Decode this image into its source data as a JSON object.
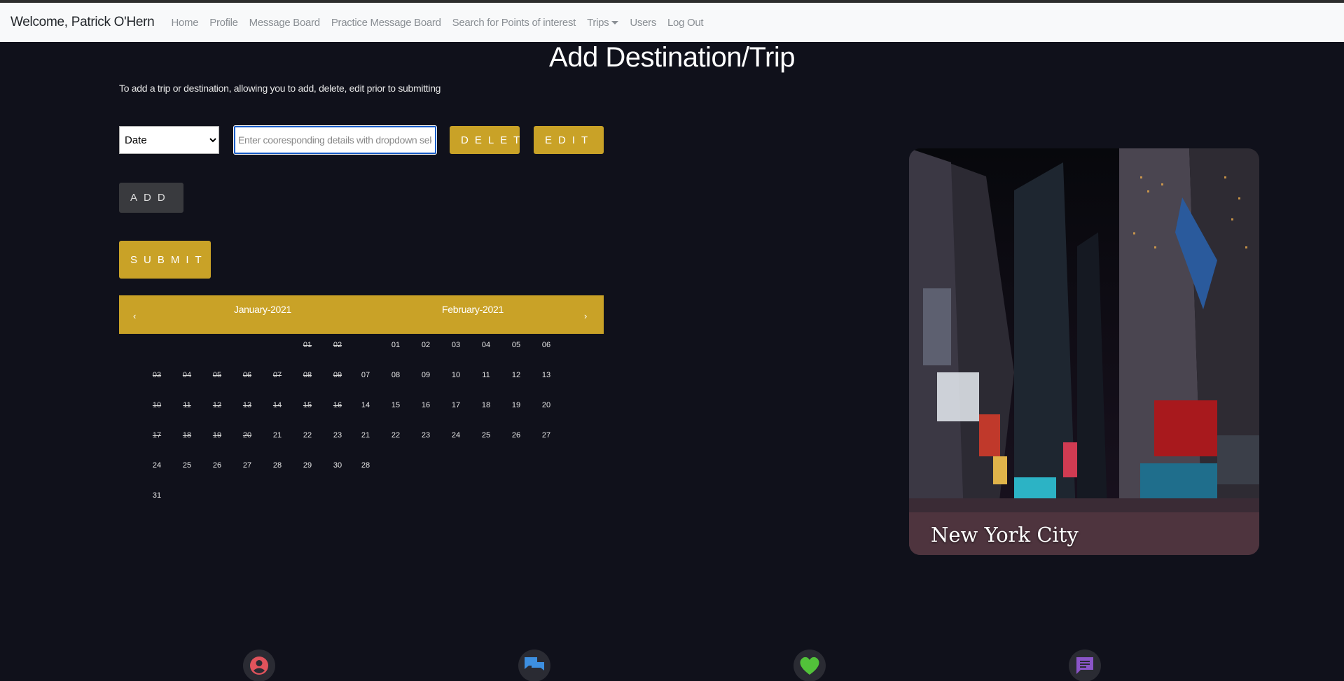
{
  "navbar": {
    "brand": "Welcome, Patrick O'Hern",
    "links": [
      "Home",
      "Profile",
      "Message Board",
      "Practice Message Board",
      "Search for Points of interest",
      "Trips",
      "Users",
      "Log Out"
    ]
  },
  "page": {
    "title": "Add Destination/Trip",
    "intro": "To add a trip or destination, allowing you to add, delete, edit prior to submitting"
  },
  "form": {
    "dropdown_selected": "Date",
    "details_placeholder": "Enter cooresponding details with dropdown selection",
    "details_value": "",
    "delete_label": "DELETE",
    "edit_label": "EDIT",
    "add_label": "ADD",
    "submit_label": "SUBMIT"
  },
  "calendar": {
    "prev_icon": "chevron-left-icon",
    "next_icon": "chevron-right-icon",
    "months": [
      {
        "label": "January-2021",
        "first_weekday": 5,
        "days": [
          "01",
          "02",
          "03",
          "04",
          "05",
          "06",
          "07",
          "08",
          "09",
          "10",
          "11",
          "12",
          "13",
          "14",
          "15",
          "16",
          "17",
          "18",
          "19",
          "20",
          "21",
          "22",
          "23",
          "24",
          "25",
          "26",
          "27",
          "28",
          "29",
          "30",
          "31"
        ],
        "past_through": 20
      },
      {
        "label": "February-2021",
        "first_weekday": 1,
        "days": [
          "01",
          "02",
          "03",
          "04",
          "05",
          "06",
          "07",
          "08",
          "09",
          "10",
          "11",
          "12",
          "13",
          "14",
          "15",
          "16",
          "17",
          "18",
          "19",
          "20",
          "21",
          "22",
          "23",
          "24",
          "25",
          "26",
          "27",
          "28"
        ],
        "past_through": 0
      }
    ]
  },
  "featured": {
    "caption": "New York City"
  },
  "footer_icons": [
    {
      "name": "profile-icon",
      "color": "#e0535c"
    },
    {
      "name": "chat-icon",
      "color": "#3d8fe0"
    },
    {
      "name": "heart-icon",
      "color": "#52c23a"
    },
    {
      "name": "message-icon",
      "color": "#8b55c9"
    }
  ],
  "colors": {
    "background": "#10111b",
    "accent_gold": "#c9a227",
    "navbar": "#f8f9fa"
  }
}
